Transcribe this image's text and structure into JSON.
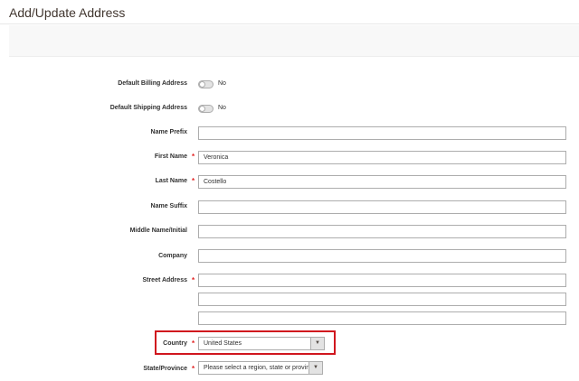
{
  "page": {
    "title": "Add/Update Address"
  },
  "toggles": {
    "default_billing": {
      "label": "Default Billing Address",
      "value": "No"
    },
    "default_shipping": {
      "label": "Default Shipping Address",
      "value": "No"
    }
  },
  "fields": {
    "name_prefix": {
      "label": "Name Prefix",
      "value": ""
    },
    "first_name": {
      "label": "First Name",
      "value": "Veronica",
      "required": "*"
    },
    "last_name": {
      "label": "Last Name",
      "value": "Costello",
      "required": "*"
    },
    "name_suffix": {
      "label": "Name Suffix",
      "value": ""
    },
    "middle_name": {
      "label": "Middle Name/Initial",
      "value": ""
    },
    "company": {
      "label": "Company",
      "value": ""
    },
    "street": {
      "label": "Street Address",
      "required": "*",
      "lines": [
        "",
        "",
        ""
      ]
    },
    "country": {
      "label": "Country",
      "required": "*",
      "selected": "United States"
    },
    "state": {
      "label": "State/Province",
      "required": "*",
      "selected": "Please select a region, state or province."
    }
  },
  "icons": {
    "dropdown": "chevron-down-icon"
  },
  "colors": {
    "required": "#e22626",
    "highlight": "#d0161e"
  }
}
